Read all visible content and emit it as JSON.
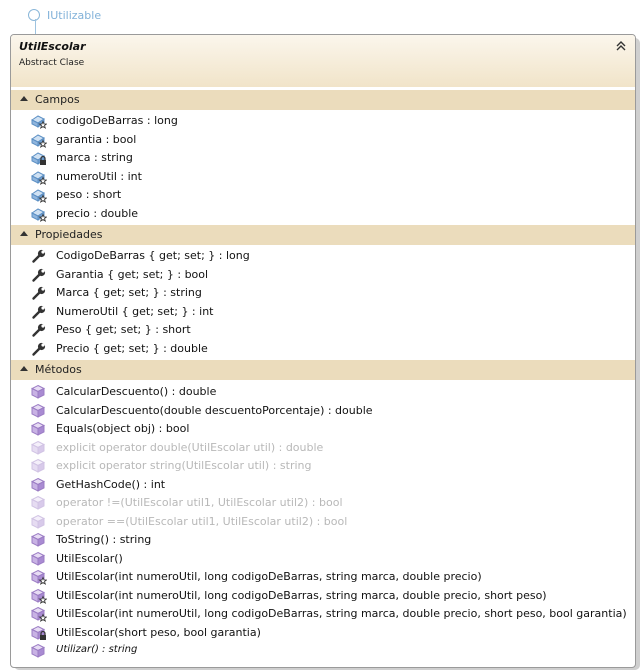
{
  "interface": {
    "label": "IUtilizable"
  },
  "class": {
    "name": "UtilEscolar",
    "kind": "Abstract Clase"
  },
  "sections": {
    "campos": {
      "title": "Campos",
      "items": [
        {
          "text": "codigoDeBarras : long",
          "icon": "field-icon"
        },
        {
          "text": "garantia : bool",
          "icon": "field-icon"
        },
        {
          "text": "marca : string",
          "icon": "private-field-icon"
        },
        {
          "text": "numeroUtil : int",
          "icon": "field-icon"
        },
        {
          "text": "peso : short",
          "icon": "field-icon"
        },
        {
          "text": "precio : double",
          "icon": "field-icon"
        }
      ]
    },
    "propiedades": {
      "title": "Propiedades",
      "items": [
        {
          "text": "CodigoDeBarras { get; set; } : long",
          "icon": "property-icon"
        },
        {
          "text": "Garantia { get; set; } : bool",
          "icon": "property-icon"
        },
        {
          "text": "Marca { get; set; } : string",
          "icon": "property-icon"
        },
        {
          "text": "NumeroUtil { get; set; } : int",
          "icon": "property-icon"
        },
        {
          "text": "Peso { get; set; } : short",
          "icon": "property-icon"
        },
        {
          "text": "Precio { get; set; } : double",
          "icon": "property-icon"
        }
      ]
    },
    "metodos": {
      "title": "Métodos",
      "items": [
        {
          "text": "CalcularDescuento() : double",
          "icon": "method-icon"
        },
        {
          "text": "CalcularDescuento(double descuentoPorcentaje) : double",
          "icon": "method-icon"
        },
        {
          "text": "Equals(object obj) : bool",
          "icon": "method-icon"
        },
        {
          "text": "explicit operator double(UtilEscolar util) : double",
          "icon": "method-icon",
          "dim": true
        },
        {
          "text": "explicit operator string(UtilEscolar util) : string",
          "icon": "method-icon",
          "dim": true
        },
        {
          "text": "GetHashCode() : int",
          "icon": "method-icon"
        },
        {
          "text": "operator !=(UtilEscolar util1, UtilEscolar util2) : bool",
          "icon": "method-icon",
          "dim": true
        },
        {
          "text": "operator ==(UtilEscolar util1, UtilEscolar util2) : bool",
          "icon": "method-icon",
          "dim": true
        },
        {
          "text": "ToString() : string",
          "icon": "method-icon"
        },
        {
          "text": "UtilEscolar()",
          "icon": "method-icon"
        },
        {
          "text": "UtilEscolar(int numeroUtil, long codigoDeBarras, string marca, double precio)",
          "icon": "protected-method-icon"
        },
        {
          "text": "UtilEscolar(int numeroUtil, long codigoDeBarras, string marca, double precio, short peso)",
          "icon": "protected-method-icon"
        },
        {
          "text": "UtilEscolar(int numeroUtil, long codigoDeBarras, string marca, double precio, short peso, bool garantia)",
          "icon": "protected-method-icon"
        },
        {
          "text": "UtilEscolar(short peso, bool garantia)",
          "icon": "private-method-icon"
        },
        {
          "text": "Utilizar() : string",
          "icon": "method-icon",
          "italic": true
        }
      ]
    }
  },
  "colors": {
    "header_gradient_top": "#fbf6ec",
    "header_gradient_bottom": "#f1e4c9",
    "section_bar": "#ebdcbc",
    "field_icon": "#5b8fc4",
    "property_icon": "#333333",
    "method_icon": "#9b7cc4",
    "interface_connector": "#8ab7d9"
  }
}
